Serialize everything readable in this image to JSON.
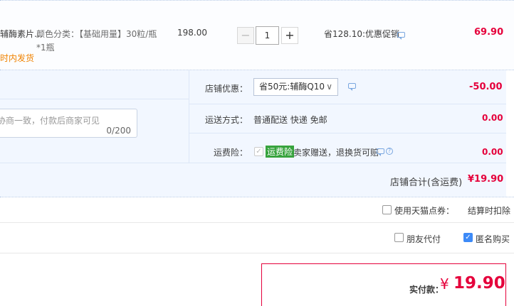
{
  "item": {
    "name": "辅酶素片…",
    "delivery": "时内发货",
    "sku_line1": "颜色分类：【基础用量】30粒/瓶",
    "sku_line2": "*1瓶",
    "unit_price": "198.00",
    "quantity": "1",
    "minus": "−",
    "plus": "+",
    "promo": "省128.10:优惠促销",
    "subtotal": "69.90"
  },
  "shop": {
    "discount_label": "店铺优惠：",
    "discount_selected": "省50元:辅酶Q10",
    "discount_amount": "-50.00",
    "shipping_label": "运送方式：",
    "shipping_value": "普通配送 快递 免邮",
    "shipping_amount": "0.00",
    "insurance_label": "运费险：",
    "insurance_tag": "运费险",
    "insurance_text": "卖家赠送，退换货可赔",
    "insurance_amount": "0.00",
    "message_placeholder": "协商一致，付款后商家可见",
    "message_count": "0/200",
    "total_label": "店铺合计(含运费)",
    "total_amount": "¥19.90"
  },
  "options": {
    "tmall_points_label": "使用天猫点券：",
    "tmall_points_note": "结算时扣除",
    "friend_pay_label": "朋友代付",
    "anonymous_label": "匿名购买"
  },
  "payment": {
    "label": "实付款：",
    "currency": "¥",
    "amount": "19.90"
  },
  "colors": {
    "price_red": "#e5003b",
    "panel_bg": "#f2f7ff",
    "accent_blue": "#3d8af7",
    "insurance_green": "#37a33d"
  }
}
